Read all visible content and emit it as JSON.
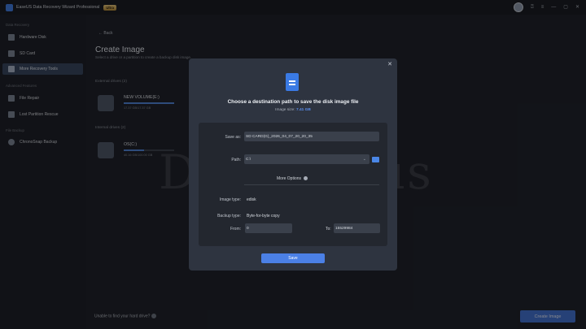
{
  "app": {
    "title": "EaseUS Data Recovery Wizard Professional",
    "badge": "Ultra"
  },
  "window_controls": [
    "help-icon",
    "menu-icon",
    "minimize-icon",
    "maximize-icon",
    "close-icon"
  ],
  "sidebar": {
    "section_data_recovery": "Data Recovery",
    "section_advanced": "Advanced Features",
    "section_backup": "File Backup",
    "items": [
      {
        "label": "Hardware Disk"
      },
      {
        "label": "SD Card"
      },
      {
        "label": "More Recovery Tools"
      },
      {
        "label": "File Repair"
      },
      {
        "label": "Lost Partition Rescue"
      },
      {
        "label": "ChronoSnap Backup"
      }
    ]
  },
  "main": {
    "back": "Back",
    "title": "Create Image",
    "subtitle": "Select a drive or a partition to create a backup disk image.",
    "external_label": "External drives (2)",
    "internal_label": "Internal drives (2)",
    "drives": [
      {
        "name": "NEW VOLUME(E:)",
        "size": "17.37 GB/17.37 GB",
        "fill": 1.0
      },
      {
        "name": "OS(C:)",
        "size": "40.16 GB/100.00 GB",
        "fill": 0.4
      }
    ],
    "unable": "Unable to find your hard drive?",
    "create_button": "Create Image"
  },
  "modal": {
    "title": "Choose a destination path to save the disk image file",
    "image_size_label": "Image size:",
    "image_size_value": "7.41 GB",
    "save_as_label": "Save as:",
    "save_as_value": "SD CARD(G)_2026_04_07_20_20_35",
    "path_label": "Path:",
    "path_value": "C:\\",
    "more_options": "More Options",
    "image_type_label": "Image type:",
    "image_type_value": "edisk",
    "backup_type_label": "Backup type:",
    "backup_type_value": "Byte-for-byte copy",
    "from_label": "From:",
    "from_value": "0",
    "to_label": "To:",
    "to_value": "15529984",
    "save_button": "Save"
  },
  "watermark": "Dealarious",
  "colors": {
    "accent": "#4b80e6",
    "active_nav": "#34425a",
    "modal_bg": "#2e3440"
  }
}
